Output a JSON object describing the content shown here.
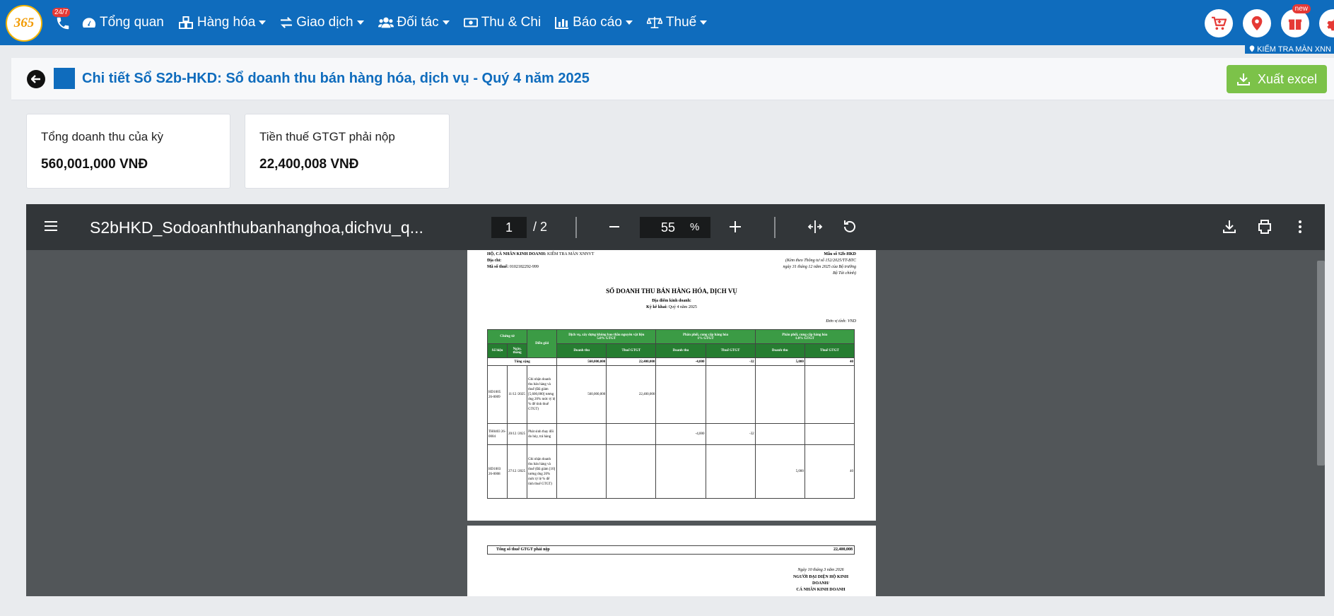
{
  "nav": {
    "logo_text": "365",
    "badge_247": "24/7",
    "items": [
      {
        "label": "Tổng quan",
        "icon": "dashboard-icon",
        "dropdown": false
      },
      {
        "label": "Hàng hóa",
        "icon": "boxes-icon",
        "dropdown": true
      },
      {
        "label": "Giao dịch",
        "icon": "exchange-icon",
        "dropdown": true
      },
      {
        "label": "Đối tác",
        "icon": "users-icon",
        "dropdown": true
      },
      {
        "label": "Thu & Chi",
        "icon": "money-icon",
        "dropdown": false
      },
      {
        "label": "Báo cáo",
        "icon": "bar-chart-icon",
        "dropdown": true
      },
      {
        "label": "Thuế",
        "icon": "scale-icon",
        "dropdown": true
      }
    ],
    "new_badge": "new",
    "store_label": "KIỂM TRA MÀN XNN",
    "accent": "#0f6cbd",
    "icon_red": "#e53935"
  },
  "header": {
    "title": "Chi tiết Sổ S2b-HKD: Sổ doanh thu bán hàng hóa, dịch vụ - Quý 4 năm 2025",
    "export_label": "Xuất excel",
    "export_color": "#7cc249"
  },
  "stats": [
    {
      "label": "Tổng doanh thu của kỳ",
      "value": "560,001,000 VNĐ"
    },
    {
      "label": "Tiền thuế GTGT phải nộp",
      "value": "22,400,008 VNĐ"
    }
  ],
  "viewer": {
    "filename": "S2bHKD_Sodoanhthubanhanghoa,dichvu_q...",
    "page": "1",
    "total": "/ 2",
    "zoom": "55",
    "zoom_unit": "%"
  },
  "doc": {
    "owner_label": "HỘ, CÁ NHÂN KINH DOANH:",
    "owner_value": "KIỂM TRA MÀN XNNVT",
    "address_label": "Địa chỉ:",
    "taxcode_label": "Mã số thuế:",
    "taxcode_value": "0102182292-999",
    "form_code": "Mẫu số S2b-HKD",
    "form_note1": "(Kèm theo Thông tư số 152/2025/TT-BTC",
    "form_note2": "ngày 31 tháng 12 năm 2025 của Bộ trưởng",
    "form_note3": "Bộ Tài chính)",
    "title": "SỔ DOANH THU BÁN HÀNG HÓA, DỊCH VỤ",
    "location_label": "Địa điểm kinh doanh:",
    "period_label": "Kỳ kê khai:",
    "period_value": "Quý 4 năm 2025",
    "unit": "Đơn vị tính: VND",
    "col_voucher": "Chứng từ",
    "col_desc": "Diễn giải",
    "col_no": "Số hiệu",
    "col_date": "Ngày, tháng",
    "group1": "Dịch vụ, xây dựng không bao thầu nguyên vật liệu",
    "group1_rate": "5.0% GTGT",
    "group2": "Phân phối, cung cấp hàng hóa",
    "group2_rate": "1% GTGT",
    "group3": "Phân phối, cung cấp hàng hóa",
    "group3_rate": "1.0% GTGT",
    "col_rev": "Doanh thu",
    "col_vat": "Thuế GTGT",
    "total_label": "Tổng cộng",
    "totals": [
      "560,000,000",
      "22,400,000",
      "-4,000",
      "-32",
      "5,000",
      "40"
    ],
    "rows": [
      {
        "no": "HD1005 26-0009",
        "date": "11/12 /2025",
        "desc": "Ghi nhận doanh thu bán hàng và thuế (Đã giảm [5,600,000] tương ứng 20% mức tỷ lệ % để tính thuế GTGT)",
        "vals": [
          "560,000,000",
          "22,400,000",
          "",
          "",
          "",
          ""
        ]
      },
      {
        "no": "TH0403 26-0004",
        "date": "20/12 /2025",
        "desc": "Phát sinh thay đổi do hủy, trả hàng",
        "vals": [
          "",
          "",
          "-4,000",
          "-32",
          "",
          ""
        ]
      },
      {
        "no": "HD1003 26-0008",
        "date": "27/12 /2025",
        "desc": "Ghi nhận doanh thu bán hàng và thuế (Đã giảm [10] tương ứng 20% mức tỷ lệ % để tính thuế GTGT)",
        "vals": [
          "",
          "",
          "",
          "",
          "5,000",
          "40"
        ]
      }
    ],
    "vat_total_label": "Tổng số thuế GTGT phải nộp",
    "vat_total_value": "22,400,008",
    "sign_date": "Ngày 10 tháng 3 năm 2026",
    "sign_title1": "NGƯỜI ĐẠI DIỆN HỘ KINH",
    "sign_title2": "DOANH/",
    "sign_title3": "CÁ NHÂN KINH DOANH"
  }
}
